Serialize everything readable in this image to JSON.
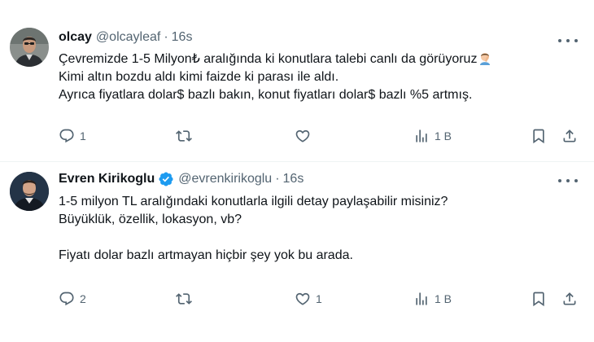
{
  "tweets": [
    {
      "name": "olcay",
      "handle": "@olcayleaf",
      "separator": "·",
      "time": "16s",
      "lines": [
        "Çevremizde 1-5 Milyon₺ aralığında ki konutlara talebi canlı da görüyoruz",
        "Kimi altın bozdu aldı kimi faizde ki parası ile aldı.",
        "Ayrıca fiyatlara dolar$ bazlı bakın, konut fiyatları dolar$ bazlı %5 artmış."
      ],
      "reply_count": "1",
      "retweet_count": "",
      "like_count": "",
      "view_count": "1 B"
    },
    {
      "name": "Evren Kirikoglu",
      "handle": "@evrenkirikoglu",
      "separator": "·",
      "time": "16s",
      "lines": [
        "1-5 milyon TL aralığındaki konutlarla ilgili detay paylaşabilir misiniz?",
        "Büyüklük, özellik, lokasyon, vb?",
        "",
        "Fiyatı dolar bazlı artmayan hiçbir şey yok bu arada."
      ],
      "reply_count": "2",
      "retweet_count": "",
      "like_count": "1",
      "view_count": "1 B"
    }
  ],
  "icons": {
    "reply": "reply-icon",
    "retweet": "retweet-icon",
    "like": "heart-icon",
    "views": "views-icon",
    "bookmark": "bookmark-icon",
    "share": "share-icon",
    "more": "more-icon",
    "verified": "verified-badge-icon",
    "emoji": "man-facepalming-emoji"
  },
  "colors": {
    "text": "#0f1419",
    "secondary": "#536471",
    "verified": "#1d9bf0",
    "divider": "#eff3f4"
  }
}
